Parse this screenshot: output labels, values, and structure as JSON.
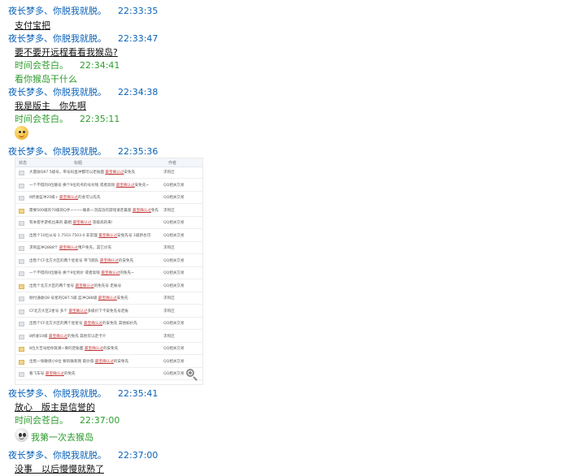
{
  "chat": {
    "m1": {
      "nick": "夜长梦多、你脱我就脱。",
      "time": "22:33:35"
    },
    "m1_body": "支付宝把",
    "m2": {
      "nick": "夜长梦多、你脱我就脱。",
      "time": "22:33:47"
    },
    "m2_body": "要不要开远程看看我猴岛?",
    "m3": {
      "nick": "时间会苍白。",
      "time": "22:34:41"
    },
    "m3_body": "看你猴岛干什么",
    "m4": {
      "nick": "夜长梦多、你脱我就脱。",
      "time": "22:34:38"
    },
    "m4_body": "我是版主　你先啊",
    "m5": {
      "nick": "时间会苍白。",
      "time": "22:35:11"
    },
    "m6": {
      "nick": "夜长梦多、你脱我就脱。",
      "time": "22:35:36"
    },
    "m7": {
      "nick": "夜长梦多、你脱我就脱。",
      "time": "22:35:41"
    },
    "m7_body": "放心　版主是信誉的",
    "m8": {
      "nick": "时间会苍白。",
      "time": "22:37:00"
    },
    "m8_body": "我第一次去猴岛",
    "m9": {
      "nick": "夜长梦多、你脱我就脱。",
      "time": "22:37:00"
    },
    "m9_body": "没事　以后慢慢就熟了"
  },
  "shot": {
    "col_status": "状态",
    "col_title": "标题",
    "col_author": "作者",
    "rows": [
      {
        "pre": "大量收Q87.5级号，带号码直冲都可以走账面 ",
        "link": "最宝确认过",
        "post": "安免先",
        "author": "求购区"
      },
      {
        "pre": "一个不错的0位靓号  换个9位的点的号价钱  或者高钱 ",
        "link": "最宝确认过",
        "post": "安免先~",
        "author": "QQ相关交易"
      },
      {
        "pre": "8折收蓝冲20级+ ",
        "link": "最宝确认过",
        "post": "的会可以先先",
        "author": "QQ相关交易"
      },
      {
        "pre": "需要500级的70级的Q手~~~~联系一次成功的游戏请走最基 ",
        "link": "最宝确认过",
        "post": "免先",
        "author": "求购区"
      },
      {
        "pre": "有本客手游机位来的 最相 ",
        "link": "最宝确认过",
        "post": " 等级高的来!",
        "author": "QQ相关交易"
      },
      {
        "pre": "出售个10位从号 1.7503.7503.0 非常理 ",
        "link": "最宝确认过",
        "post": "安免先号 1级新也可",
        "author": "QQ相关交易"
      },
      {
        "pre": "求购蓝冲Q888个 ",
        "link": "最宝确认过",
        "post": "用户免先，其它价先",
        "author": "求购区"
      },
      {
        "pre": "出售个CF北方大区的两个星星号  带飞跑队 ",
        "link": "最宝确认过",
        "post": "的安免先",
        "author": "QQ相关交易"
      },
      {
        "pre": "一个不错的0位靓号 换个9位到价 或者高钱 ",
        "link": "最宝确认过",
        "post": "的免先~",
        "author": "QQ相关交易"
      },
      {
        "pre": "出售个北方大区的两个星号 ",
        "link": "最宝确认过",
        "post": "的免先号 走账号",
        "author": "QQ相关交易"
      },
      {
        "pre": "刚付通收Q8  号星的Q87.5级  蓝冲Q88级 ",
        "link": "最宝确认过",
        "post": "安免先",
        "author": "求购区"
      },
      {
        "pre": "CF北方大区2星号  多个 ",
        "link": "最宝确认过",
        "post": "多级价下卡安免先号走账",
        "author": "求购区"
      },
      {
        "pre": "出售个CF北方大区的两个星星号  ",
        "link": "最宝确认过",
        "post": "的安免先  其他如价先",
        "author": "QQ相关交易"
      },
      {
        "pre": "8折收10级 ",
        "link": "最宝确认过",
        "post": "的免先  其他可以走卡介",
        "author": "求购区"
      },
      {
        "pre": "8位大吉号给你就真~要的走账面 ",
        "link": "最宝确认过",
        "post": "的安免先",
        "author": "QQ相关交易"
      },
      {
        "pre": "出售一张敏感小8位  要的联系我  取价值 ",
        "link": "最宝确认过",
        "post": "的安免先",
        "author": "QQ相关交易"
      },
      {
        "pre": "看飞车号 ",
        "link": "最宝确认过",
        "post": "的免先",
        "author": "QQ相关交易"
      }
    ]
  },
  "colors": {
    "nick_blue": "#0a62b8",
    "nick_green": "#2e9e2e",
    "link_red": "#c23a3a"
  },
  "icons": {
    "m5": "smile-emoji-icon",
    "m8": "skull-emoji-icon",
    "zoom": "zoom-in-icon"
  }
}
